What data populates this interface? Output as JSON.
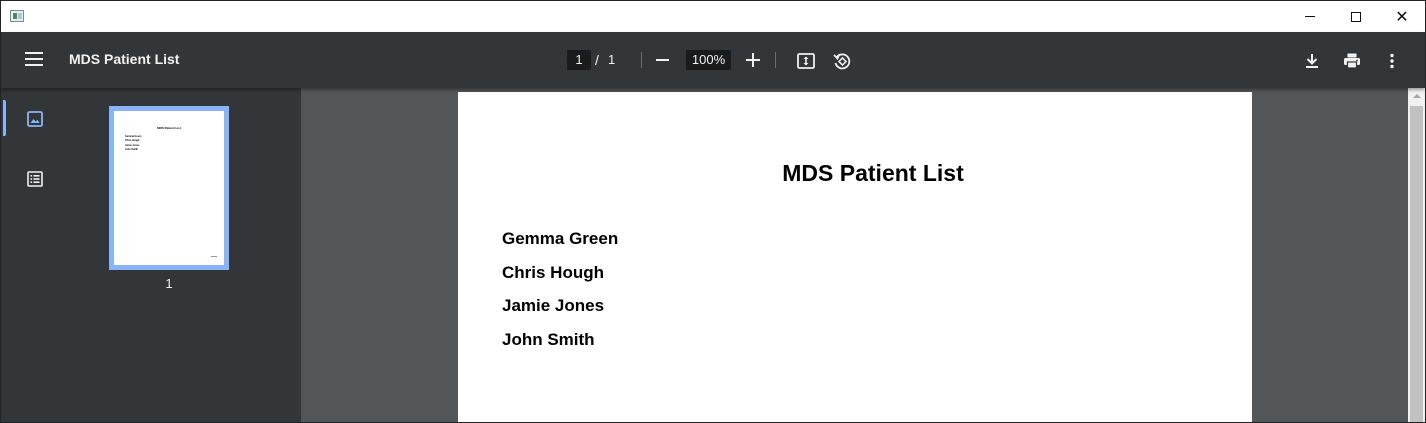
{
  "window": {
    "app_icon": "app-window-icon",
    "controls": {
      "minimize": "minimize-icon",
      "maximize": "maximize-icon",
      "close": "close-icon",
      "close_glyph": "✕"
    }
  },
  "toolbar": {
    "menu_icon": "hamburger-menu-icon",
    "title": "MDS Patient List",
    "page_current": "1",
    "page_separator": "/",
    "page_total": "1",
    "zoom": "100%",
    "icons": [
      "zoom-out-icon",
      "zoom-in-icon",
      "fit-to-page-icon",
      "rotate-icon",
      "download-icon",
      "print-icon",
      "more-options-icon"
    ]
  },
  "sidebar": {
    "tabs": [
      "thumbnails-icon",
      "document-outline-icon"
    ],
    "thumbnails": [
      {
        "label": "1",
        "title": "MDS Patient List",
        "lines": [
          "Gemma Green",
          "Chris Hough",
          "Jamie Jones",
          "John Smith"
        ]
      }
    ]
  },
  "document": {
    "title": "MDS Patient List",
    "patients": [
      "Gemma Green",
      "Chris Hough",
      "Jamie Jones",
      "John Smith"
    ]
  },
  "colors": {
    "toolbar_bg": "#323639",
    "viewer_bg": "#525659",
    "accent": "#8ab4f8",
    "text_light": "#f1f1f1"
  }
}
